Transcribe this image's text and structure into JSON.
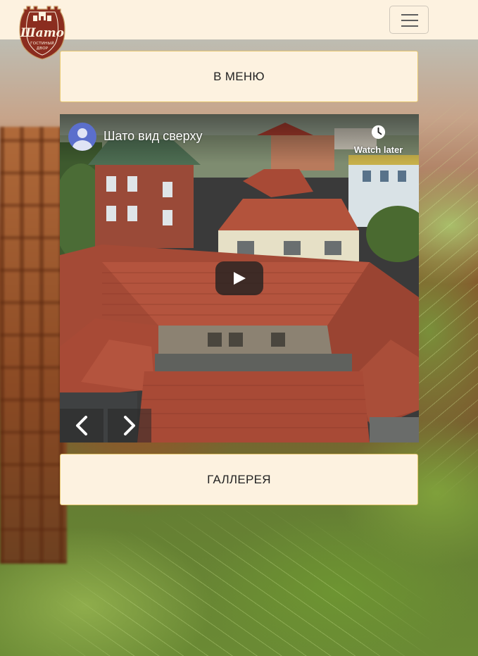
{
  "header": {
    "logo": {
      "title": "Шато",
      "subtitle_line1": "ГОСТИНЫЙ",
      "subtitle_line2": "ДВОР"
    },
    "menu_toggle_icon": "hamburger-icon"
  },
  "menu_button": {
    "label": "В МЕНЮ"
  },
  "video": {
    "title": "Шато вид сверху",
    "watch_later_label": "Watch later",
    "play_icon": "play-icon",
    "prev_icon": "chevron-left-icon",
    "next_icon": "chevron-right-icon"
  },
  "gallery_button": {
    "label": "ГАЛЛЕРЕЯ"
  },
  "colors": {
    "panel_bg": "#fdf2e0",
    "panel_border": "#e7c871",
    "logo_brand": "#8b2d1f",
    "roof": "#a44a36"
  }
}
